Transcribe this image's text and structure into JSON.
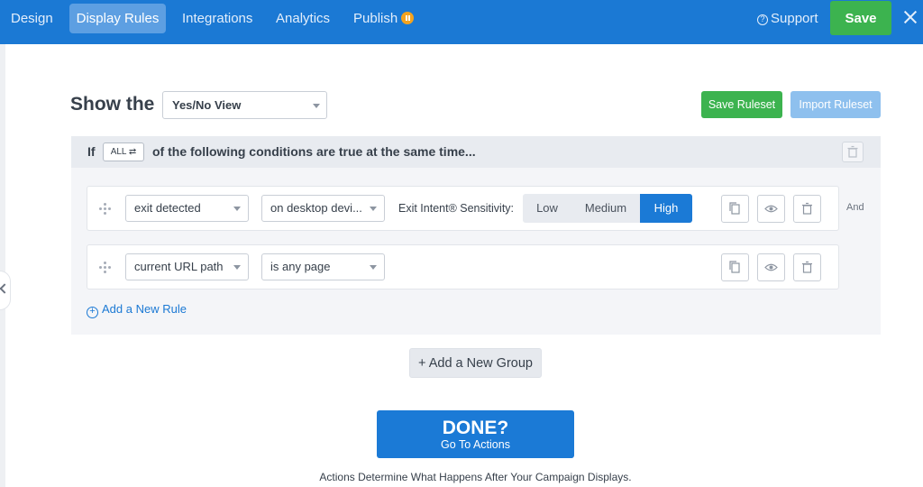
{
  "nav": {
    "tabs": [
      "Design",
      "Display Rules",
      "Integrations",
      "Analytics",
      "Publish"
    ],
    "active_tab": "Display Rules",
    "support_label": "Support",
    "save_label": "Save"
  },
  "ruleset": {
    "show_the_label": "Show the",
    "view_selected": "Yes/No View",
    "save_ruleset_label": "Save Ruleset",
    "import_ruleset_label": "Import Ruleset"
  },
  "group": {
    "if_label": "If",
    "match_mode": "ALL",
    "condition_text": "of the following conditions are true at the same time...",
    "rules": [
      {
        "condition": "exit detected",
        "operator": "on desktop devi...",
        "sensitivity_label": "Exit Intent® Sensitivity:",
        "sensitivity_options": [
          "Low",
          "Medium",
          "High"
        ],
        "sensitivity_selected": "High",
        "joiner": "And"
      },
      {
        "condition": "current URL path",
        "operator": "is any page"
      }
    ],
    "add_rule_label": "Add a New Rule"
  },
  "add_group_label": "+ Add a New Group",
  "done": {
    "title": "DONE?",
    "subtitle": "Go To Actions",
    "note": "Actions Determine What Happens After Your Campaign Displays."
  },
  "colors": {
    "brand_blue": "#1b79d4",
    "save_green": "#3cb34f",
    "publish_badge": "#f4a31e"
  }
}
